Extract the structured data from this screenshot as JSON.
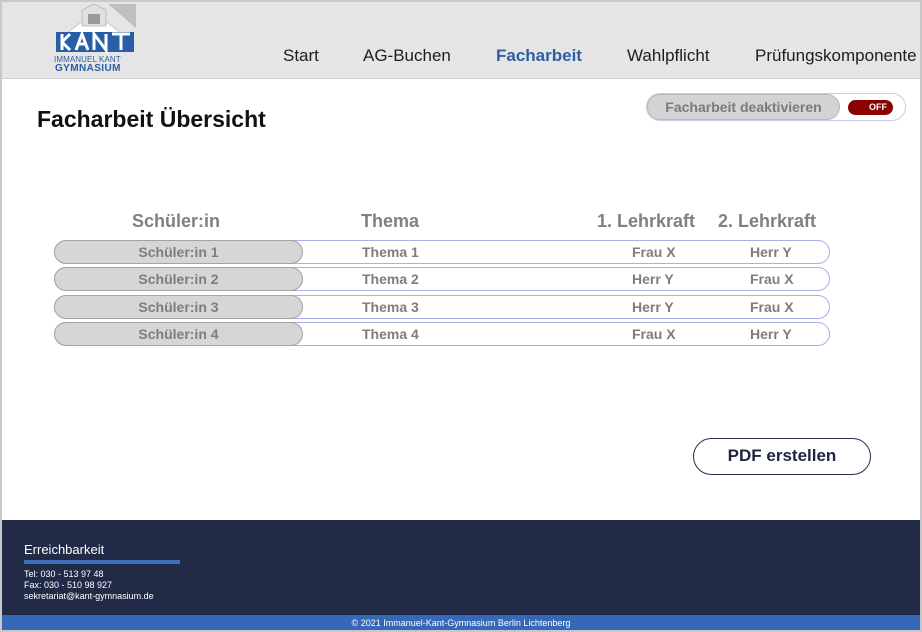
{
  "brand": {
    "line1": "IMMANUEL KANT",
    "line2": "GYMNASIUM",
    "logo_letters": "KANT",
    "colors": {
      "blue": "#2a5da8",
      "navy": "#212b47"
    }
  },
  "nav": {
    "items": [
      {
        "label": "Start"
      },
      {
        "label": "AG-Buchen"
      },
      {
        "label": "Facharbeit",
        "active": true
      },
      {
        "label": "Wahlpflicht"
      },
      {
        "label": "Prüfungskomponente"
      }
    ]
  },
  "page": {
    "title": "Facharbeit Übersicht"
  },
  "toggle": {
    "label": "Facharbeit deaktivieren",
    "state": "OFF",
    "color": "#8b0000"
  },
  "table": {
    "headers": [
      "Schüler:in",
      "Thema",
      "1. Lehrkraft",
      "2. Lehrkraft"
    ],
    "rows": [
      {
        "student": "Schüler:in 1",
        "topic": "Thema 1",
        "teacher1": "Frau X",
        "teacher2": "Herr Y"
      },
      {
        "student": "Schüler:in 2",
        "topic": "Thema 2",
        "teacher1": "Herr Y",
        "teacher2": "Frau X"
      },
      {
        "student": "Schüler:in 3",
        "topic": "Thema 3",
        "teacher1": "Herr Y",
        "teacher2": "Frau X"
      },
      {
        "student": "Schüler:in 4",
        "topic": "Thema 4",
        "teacher1": "Frau X",
        "teacher2": "Herr Y"
      }
    ]
  },
  "actions": {
    "pdf_label": "PDF erstellen"
  },
  "footer": {
    "title": "Erreichbarkeit",
    "tel": "Tel:  030 - 513 97 48",
    "fax": "Fax: 030 - 510 98 927",
    "email": "sekretariat@kant-gymnasium.de",
    "copyright": "© 2021 Immanuel-Kant-Gymnasium Berlin Lichtenberg"
  }
}
